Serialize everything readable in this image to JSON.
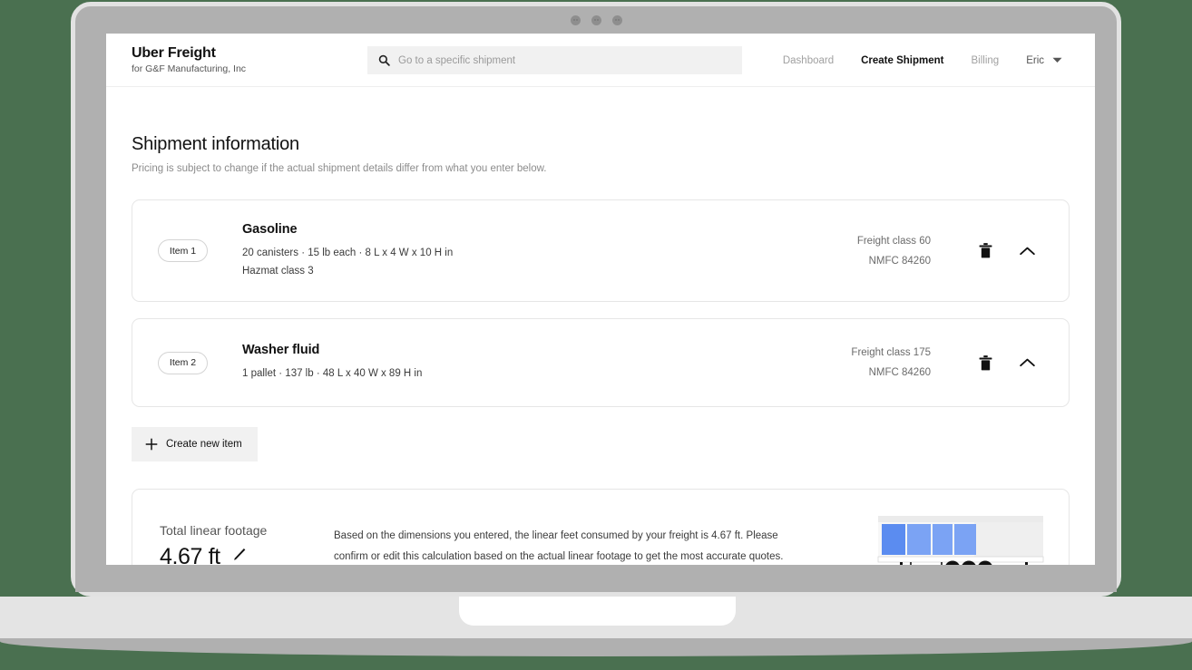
{
  "theme": {
    "background": "#4a7050",
    "accent_blue": "#5b8cf0",
    "card_border": "#e6e6e6",
    "muted_text": "#8c8c8c"
  },
  "header": {
    "brand_title": "Uber Freight",
    "brand_subtitle": "for G&F Manufacturing, Inc",
    "search": {
      "icon": "search-icon",
      "placeholder": "Go to a specific shipment",
      "value": ""
    },
    "nav": [
      {
        "label": "Dashboard",
        "active": false
      },
      {
        "label": "Create Shipment",
        "active": true
      },
      {
        "label": "Billing",
        "active": false
      }
    ],
    "user": {
      "name": "Eric",
      "caret_icon": "chevron-down-icon"
    }
  },
  "page": {
    "title": "Shipment information",
    "subtitle": "Pricing is subject to change if the actual shipment details differ from what you enter below."
  },
  "items": [
    {
      "badge": "Item 1",
      "name": "Gasoline",
      "meta_line_1": "20 canisters  ·  15 lb each  ·  8 L x 4 W x 10 H in",
      "meta_line_2": "Hazmat class 3",
      "freight_class": "Freight class 60",
      "nmfc": "NMFC 84260",
      "delete_icon": "trash-icon",
      "collapse_icon": "chevron-up-icon"
    },
    {
      "badge": "Item 2",
      "name": "Washer fluid",
      "meta_line_1": "1 pallet  ·  137 lb  ·  48 L x 40 W x 89 H in",
      "meta_line_2": "",
      "freight_class": "Freight class 175",
      "nmfc": "NMFC 84260",
      "delete_icon": "trash-icon",
      "collapse_icon": "chevron-up-icon"
    }
  ],
  "create_item_button": {
    "icon": "plus-icon",
    "label": "Create new item"
  },
  "footage": {
    "label": "Total linear footage",
    "value": "4.67 ft",
    "edit_icon": "pencil-icon",
    "description": "Based on the dimensions you entered, the linear feet consumed by your freight is 4.67 ft. Please confirm or edit this calculation based on the actual linear footage to get the most accurate quotes.",
    "illustration": "trailer-loading-diagram"
  },
  "window_chrome": {
    "bezel_dots": 3
  }
}
